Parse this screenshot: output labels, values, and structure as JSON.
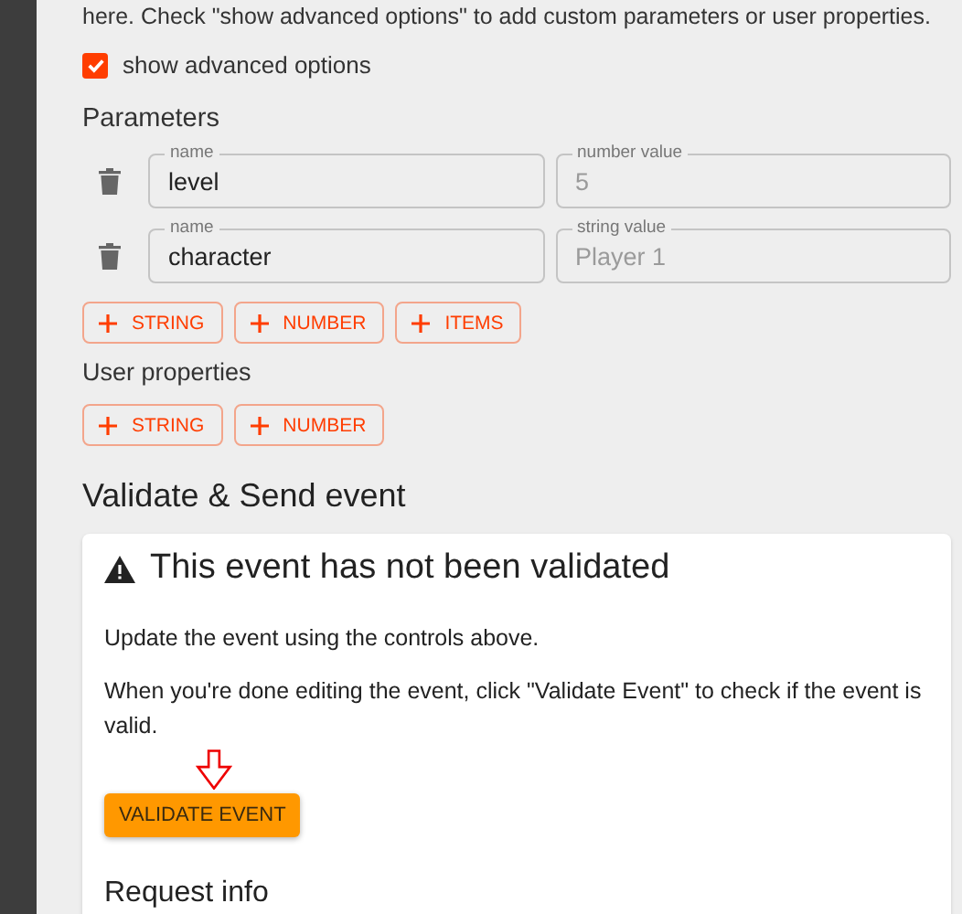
{
  "intro": "here. Check \"show advanced options\" to add custom parameters or user properties.",
  "advanced_options": {
    "label": "show advanced options",
    "checked": true
  },
  "parameters": {
    "title": "Parameters",
    "rows": [
      {
        "name_label": "name",
        "name": "level",
        "value_label": "number value",
        "value": "5",
        "value_disabled": true
      },
      {
        "name_label": "name",
        "name": "character",
        "value_label": "string value",
        "value": "Player 1",
        "value_disabled": true
      }
    ],
    "add_buttons": [
      "STRING",
      "NUMBER",
      "ITEMS"
    ]
  },
  "user_properties": {
    "title": "User properties",
    "add_buttons": [
      "STRING",
      "NUMBER"
    ]
  },
  "validate": {
    "heading": "Validate & Send event",
    "card": {
      "title": "This event has not been validated",
      "paragraphs": [
        "Update the event using the controls above.",
        "When you're done editing the event, click \"Validate Event\" to check if the event is valid."
      ],
      "button": "VALIDATE EVENT",
      "subheading": "Request info"
    }
  }
}
